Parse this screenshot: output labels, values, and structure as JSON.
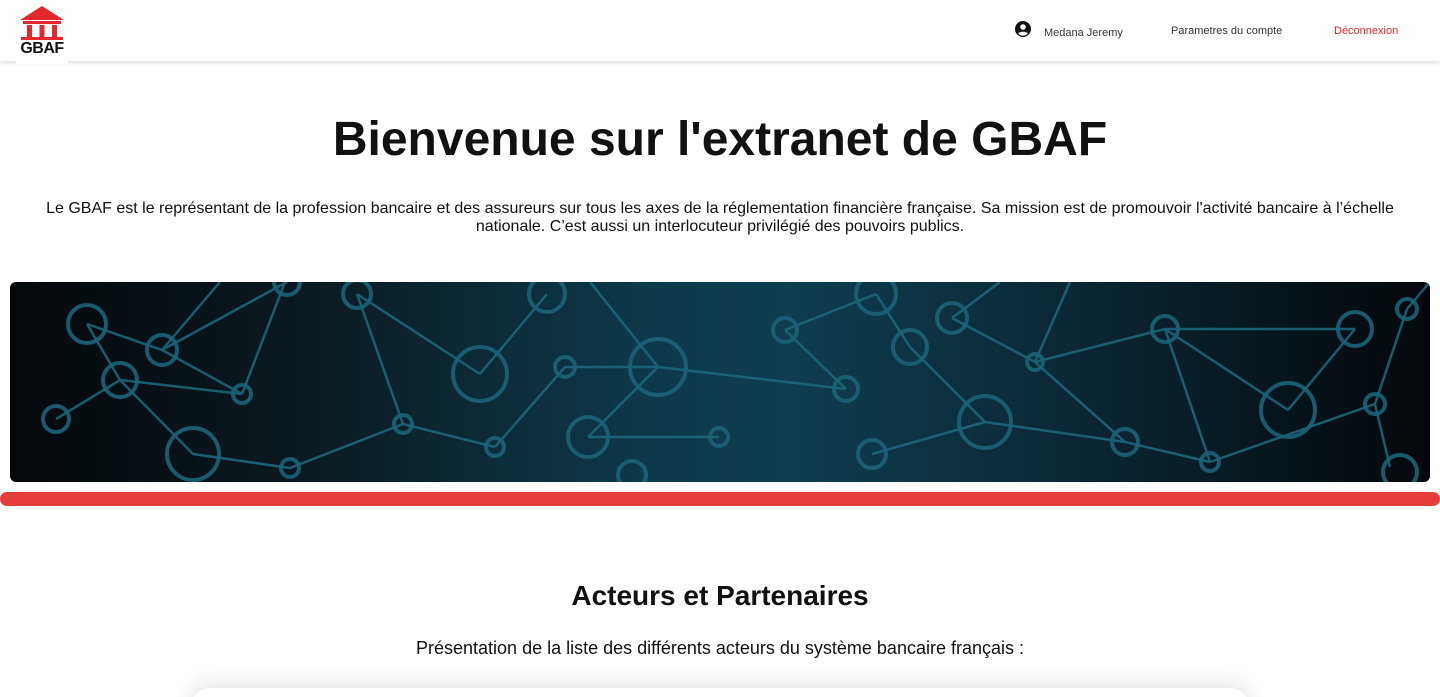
{
  "header": {
    "logo_text": "GBAF",
    "user_name": "Medana Jeremy",
    "account_link": "Parametres du compte",
    "logout_link": "Déconnexion",
    "accent_color": "#e2282b"
  },
  "icons": {
    "logo": "bank-building-icon",
    "user": "user-circle-icon"
  },
  "hero": {
    "title": "Bienvenue sur l'extranet de GBAF",
    "intro": "Le GBAF est le représentant de la profession bancaire et des assureurs sur tous les axes de la réglementation financière française. Sa mission est de promouvoir l'activité bancaire à l’échelle nationale. C’est aussi un interlocuteur privilégié des pouvoirs publics."
  },
  "colors": {
    "divider": "#e53d39",
    "banner_dark": "#04080b",
    "banner_teal": "#0e3e4f"
  },
  "partners": {
    "title": "Acteurs et Partenaires",
    "subtitle": "Présentation de la liste des différents acteurs du système bancaire français :"
  }
}
